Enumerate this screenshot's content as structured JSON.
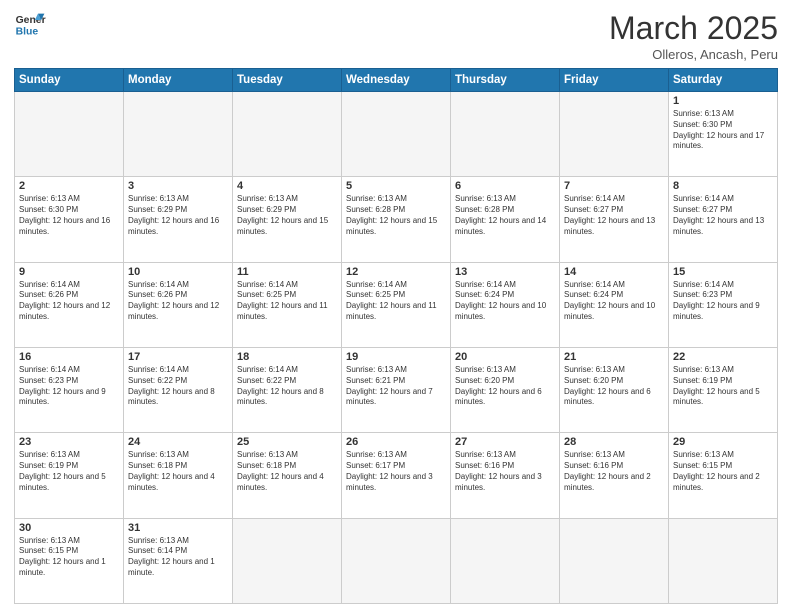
{
  "logo": {
    "text_general": "General",
    "text_blue": "Blue"
  },
  "title": "March 2025",
  "location": "Olleros, Ancash, Peru",
  "weekdays": [
    "Sunday",
    "Monday",
    "Tuesday",
    "Wednesday",
    "Thursday",
    "Friday",
    "Saturday"
  ],
  "weeks": [
    [
      {
        "day": "",
        "empty": true
      },
      {
        "day": "",
        "empty": true
      },
      {
        "day": "",
        "empty": true
      },
      {
        "day": "",
        "empty": true
      },
      {
        "day": "",
        "empty": true
      },
      {
        "day": "",
        "empty": true
      },
      {
        "day": "1",
        "sunrise": "6:13 AM",
        "sunset": "6:30 PM",
        "daylight": "12 hours and 17 minutes."
      }
    ],
    [
      {
        "day": "2",
        "sunrise": "6:13 AM",
        "sunset": "6:30 PM",
        "daylight": "12 hours and 16 minutes."
      },
      {
        "day": "3",
        "sunrise": "6:13 AM",
        "sunset": "6:29 PM",
        "daylight": "12 hours and 16 minutes."
      },
      {
        "day": "4",
        "sunrise": "6:13 AM",
        "sunset": "6:29 PM",
        "daylight": "12 hours and 15 minutes."
      },
      {
        "day": "5",
        "sunrise": "6:13 AM",
        "sunset": "6:28 PM",
        "daylight": "12 hours and 15 minutes."
      },
      {
        "day": "6",
        "sunrise": "6:13 AM",
        "sunset": "6:28 PM",
        "daylight": "12 hours and 14 minutes."
      },
      {
        "day": "7",
        "sunrise": "6:14 AM",
        "sunset": "6:27 PM",
        "daylight": "12 hours and 13 minutes."
      },
      {
        "day": "8",
        "sunrise": "6:14 AM",
        "sunset": "6:27 PM",
        "daylight": "12 hours and 13 minutes."
      }
    ],
    [
      {
        "day": "9",
        "sunrise": "6:14 AM",
        "sunset": "6:26 PM",
        "daylight": "12 hours and 12 minutes."
      },
      {
        "day": "10",
        "sunrise": "6:14 AM",
        "sunset": "6:26 PM",
        "daylight": "12 hours and 12 minutes."
      },
      {
        "day": "11",
        "sunrise": "6:14 AM",
        "sunset": "6:25 PM",
        "daylight": "12 hours and 11 minutes."
      },
      {
        "day": "12",
        "sunrise": "6:14 AM",
        "sunset": "6:25 PM",
        "daylight": "12 hours and 11 minutes."
      },
      {
        "day": "13",
        "sunrise": "6:14 AM",
        "sunset": "6:24 PM",
        "daylight": "12 hours and 10 minutes."
      },
      {
        "day": "14",
        "sunrise": "6:14 AM",
        "sunset": "6:24 PM",
        "daylight": "12 hours and 10 minutes."
      },
      {
        "day": "15",
        "sunrise": "6:14 AM",
        "sunset": "6:23 PM",
        "daylight": "12 hours and 9 minutes."
      }
    ],
    [
      {
        "day": "16",
        "sunrise": "6:14 AM",
        "sunset": "6:23 PM",
        "daylight": "12 hours and 9 minutes."
      },
      {
        "day": "17",
        "sunrise": "6:14 AM",
        "sunset": "6:22 PM",
        "daylight": "12 hours and 8 minutes."
      },
      {
        "day": "18",
        "sunrise": "6:14 AM",
        "sunset": "6:22 PM",
        "daylight": "12 hours and 8 minutes."
      },
      {
        "day": "19",
        "sunrise": "6:13 AM",
        "sunset": "6:21 PM",
        "daylight": "12 hours and 7 minutes."
      },
      {
        "day": "20",
        "sunrise": "6:13 AM",
        "sunset": "6:20 PM",
        "daylight": "12 hours and 6 minutes."
      },
      {
        "day": "21",
        "sunrise": "6:13 AM",
        "sunset": "6:20 PM",
        "daylight": "12 hours and 6 minutes."
      },
      {
        "day": "22",
        "sunrise": "6:13 AM",
        "sunset": "6:19 PM",
        "daylight": "12 hours and 5 minutes."
      }
    ],
    [
      {
        "day": "23",
        "sunrise": "6:13 AM",
        "sunset": "6:19 PM",
        "daylight": "12 hours and 5 minutes."
      },
      {
        "day": "24",
        "sunrise": "6:13 AM",
        "sunset": "6:18 PM",
        "daylight": "12 hours and 4 minutes."
      },
      {
        "day": "25",
        "sunrise": "6:13 AM",
        "sunset": "6:18 PM",
        "daylight": "12 hours and 4 minutes."
      },
      {
        "day": "26",
        "sunrise": "6:13 AM",
        "sunset": "6:17 PM",
        "daylight": "12 hours and 3 minutes."
      },
      {
        "day": "27",
        "sunrise": "6:13 AM",
        "sunset": "6:16 PM",
        "daylight": "12 hours and 3 minutes."
      },
      {
        "day": "28",
        "sunrise": "6:13 AM",
        "sunset": "6:16 PM",
        "daylight": "12 hours and 2 minutes."
      },
      {
        "day": "29",
        "sunrise": "6:13 AM",
        "sunset": "6:15 PM",
        "daylight": "12 hours and 2 minutes."
      }
    ],
    [
      {
        "day": "30",
        "sunrise": "6:13 AM",
        "sunset": "6:15 PM",
        "daylight": "12 hours and 1 minute."
      },
      {
        "day": "31",
        "sunrise": "6:13 AM",
        "sunset": "6:14 PM",
        "daylight": "12 hours and 1 minute."
      },
      {
        "day": "",
        "empty": true
      },
      {
        "day": "",
        "empty": true
      },
      {
        "day": "",
        "empty": true
      },
      {
        "day": "",
        "empty": true
      },
      {
        "day": "",
        "empty": true
      }
    ]
  ]
}
